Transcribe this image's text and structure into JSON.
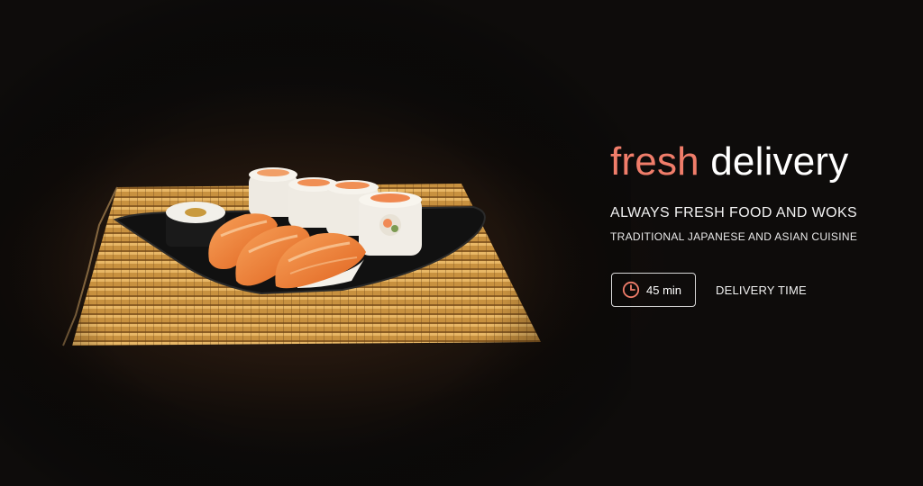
{
  "hero": {
    "headline_accent": "fresh",
    "headline_rest": "delivery",
    "tagline": "ALWAYS FRESH FOOD AND WOKS",
    "subtagline": "TRADITIONAL JAPANESE AND ASIAN CUISINE",
    "accent_color": "#f07d6a"
  },
  "delivery": {
    "time": "45 min",
    "label": "DELIVERY TIME",
    "icon": "clock-icon"
  }
}
